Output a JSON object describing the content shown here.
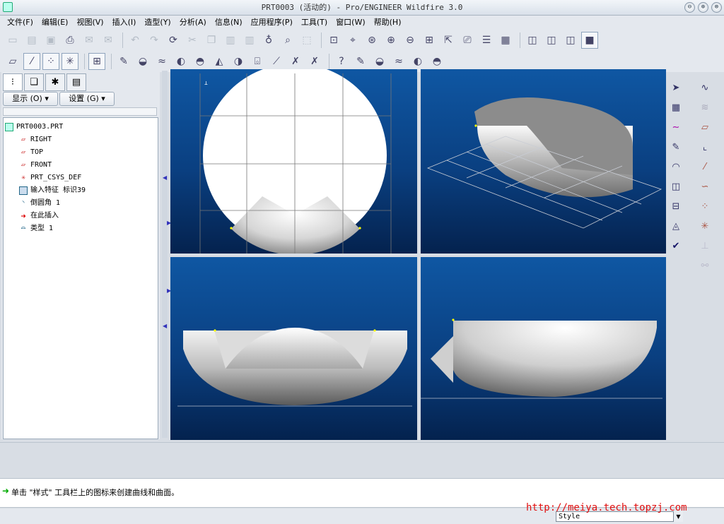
{
  "window": {
    "title": "PRT0003 (活动的) - Pro/ENGINEER Wildfire 3.0",
    "minimize": "⊖",
    "restore": "⊕",
    "close": "⊗"
  },
  "menu": [
    "文件(F)",
    "编辑(E)",
    "视图(V)",
    "插入(I)",
    "造型(Y)",
    "分析(A)",
    "信息(N)",
    "应用程序(P)",
    "工具(T)",
    "窗口(W)",
    "帮助(H)"
  ],
  "navigator": {
    "tabs": [
      "model-tree",
      "layers",
      "favorites",
      "folder"
    ],
    "show_button": "显示 (O) ▾",
    "settings_button": "设置 (G) ▾"
  },
  "tree": [
    {
      "label": "PRT0003.PRT",
      "icon": "part-icon"
    },
    {
      "label": "RIGHT",
      "icon": "datum-plane-icon"
    },
    {
      "label": "TOP",
      "icon": "datum-plane-icon"
    },
    {
      "label": "FRONT",
      "icon": "datum-plane-icon"
    },
    {
      "label": "PRT_CSYS_DEF",
      "icon": "csys-icon"
    },
    {
      "label": "输入特征 标识39",
      "icon": "import-feature-icon"
    },
    {
      "label": "倒圆角 1",
      "icon": "round-icon"
    },
    {
      "label": "在此插入",
      "icon": "insert-here-arrow-icon"
    },
    {
      "label": "类型 1",
      "icon": "style-feature-icon"
    }
  ],
  "message": "单击 \"样式\" 工具栏上的图标来创建曲线和曲面。",
  "status": {
    "filter": "Style"
  },
  "watermark": "http://meiya.tech.topzj.com",
  "viewports": [
    "top-view",
    "isometric-view",
    "front-view",
    "side-view"
  ],
  "colors": {
    "viewport_top": "#0f57a3",
    "viewport_bottom": "#04224e",
    "watermark": "#e01010"
  }
}
